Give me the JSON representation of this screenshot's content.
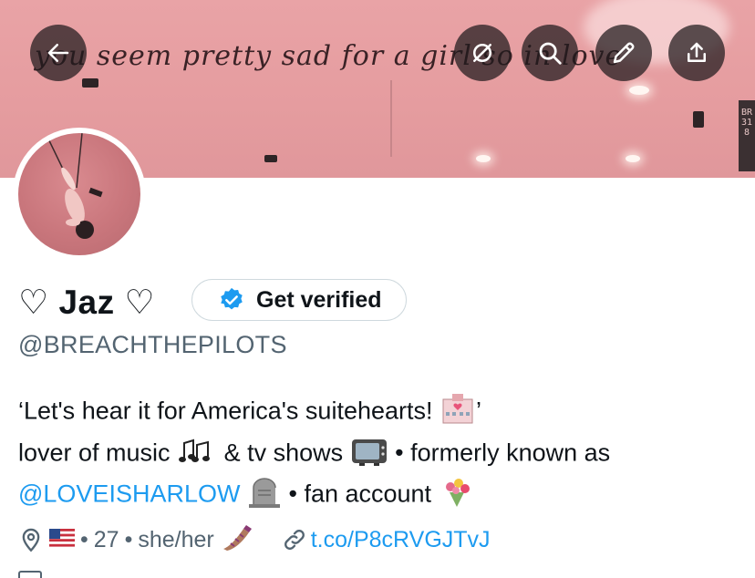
{
  "banner": {
    "script_text": "you seem pretty sad for a girl so in love"
  },
  "header_buttons": [
    {
      "name": "back-button",
      "icon": "back-arrow-icon"
    },
    {
      "name": "translate-button",
      "icon": "translate-icon"
    },
    {
      "name": "search-button",
      "icon": "search-icon"
    },
    {
      "name": "edit-button",
      "icon": "pencil-icon"
    },
    {
      "name": "share-button",
      "icon": "share-icon"
    }
  ],
  "profile": {
    "name": "♡ Jaz ♡",
    "verify_label": "Get verified",
    "handle": "@BREACHTHEPILOTS"
  },
  "bio": {
    "line1": "‘Let's hear it for America's suitehearts! ",
    "line1_end": "’",
    "line2_a": "lover of music ",
    "line2_b": " & tv shows ",
    "line2_c": " • formerly known as",
    "mention": "@LOVEISHARLOW",
    "line3_b": " • fan account "
  },
  "meta": {
    "age": "27",
    "pronouns": "she/her",
    "sep": "•",
    "link": "t.co/P8cRVGJTvJ"
  },
  "colors": {
    "accent": "#1d9bf0",
    "secondary_text": "#536471",
    "banner_pink": "#e59c9f"
  }
}
